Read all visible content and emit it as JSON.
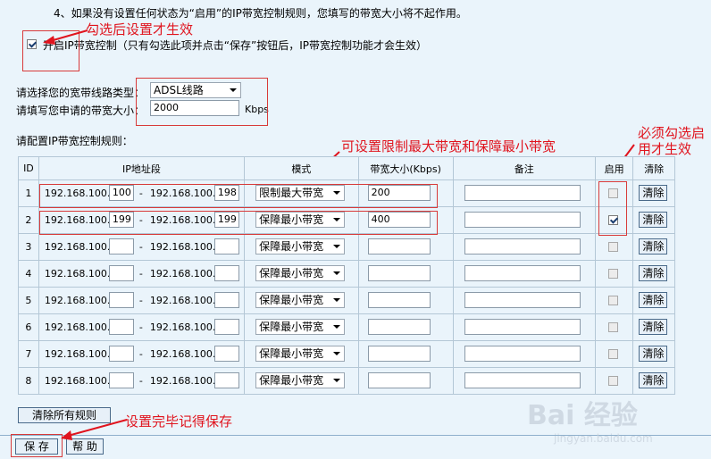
{
  "top_note": "4、如果没有设置任何状态为“启用”的IP带宽控制规则，您填写的带宽大小将不起作用。",
  "enable": {
    "checked": true,
    "label": "开启IP带宽控制（只有勾选此项并点击“保存”按钮后，IP带宽控制功能才会生效）"
  },
  "annotations": {
    "check_effect": "勾选后设置才生效",
    "limit_text": "可设置限制最大带宽和保障最小带宽",
    "must_check": "必须勾选启用才生效",
    "save_reminder": "设置完毕记得保存"
  },
  "line_type": {
    "label": "请选择您的宽带线路类型：",
    "value": "ADSL线路"
  },
  "bandwidth": {
    "label": "请填写您申请的带宽大小：",
    "value": "2000",
    "unit": "Kbps"
  },
  "rules_title": "请配置IP带宽控制规则：",
  "table": {
    "headers": [
      "ID",
      "IP地址段",
      "模式",
      "带宽大小(Kbps)",
      "备注",
      "启用",
      "清除"
    ],
    "prefix": "192.168.100.",
    "dash": "-",
    "clear_label": "清除",
    "rows": [
      {
        "id": "1",
        "start": "100",
        "end": "198",
        "mode": "限制最大带宽",
        "bw": "200",
        "note": "",
        "enabled": false
      },
      {
        "id": "2",
        "start": "199",
        "end": "199",
        "mode": "保障最小带宽",
        "bw": "400",
        "note": "",
        "enabled": true
      },
      {
        "id": "3",
        "start": "",
        "end": "",
        "mode": "保障最小带宽",
        "bw": "",
        "note": "",
        "enabled": false
      },
      {
        "id": "4",
        "start": "",
        "end": "",
        "mode": "保障最小带宽",
        "bw": "",
        "note": "",
        "enabled": false
      },
      {
        "id": "5",
        "start": "",
        "end": "",
        "mode": "保障最小带宽",
        "bw": "",
        "note": "",
        "enabled": false
      },
      {
        "id": "6",
        "start": "",
        "end": "",
        "mode": "保障最小带宽",
        "bw": "",
        "note": "",
        "enabled": false
      },
      {
        "id": "7",
        "start": "",
        "end": "",
        "mode": "保障最小带宽",
        "bw": "",
        "note": "",
        "enabled": false
      },
      {
        "id": "8",
        "start": "",
        "end": "",
        "mode": "保障最小带宽",
        "bw": "",
        "note": "",
        "enabled": false
      }
    ]
  },
  "buttons": {
    "clear_all": "清除所有规则",
    "save": "保 存",
    "help": "帮 助"
  },
  "watermark": {
    "main": "Bai 经验",
    "sub": "jingyan.baidu.com"
  }
}
